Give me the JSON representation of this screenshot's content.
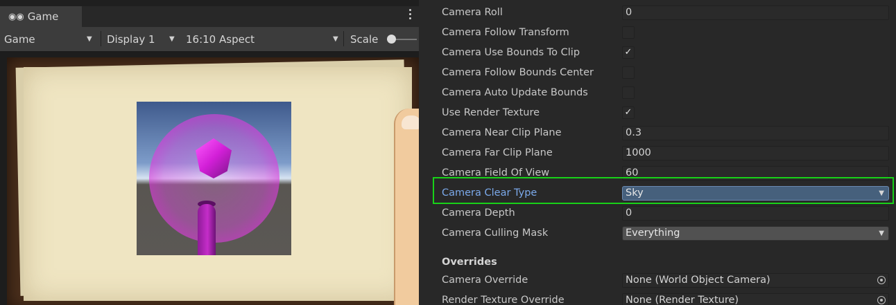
{
  "game_view": {
    "tab_label": "Game",
    "tab_icon": "gamepad-icon",
    "toolbar": {
      "mode": "Game",
      "display": "Display 1",
      "aspect": "16:10 Aspect",
      "scale_label": "Scale",
      "scale_value": 0.1
    }
  },
  "inspector": {
    "properties": [
      {
        "label": "Camera Roll",
        "kind": "field",
        "value": "0"
      },
      {
        "label": "Camera Follow Transform",
        "kind": "check",
        "value": ""
      },
      {
        "label": "Camera Use Bounds To Clip",
        "kind": "check",
        "value": "✓"
      },
      {
        "label": "Camera Follow Bounds Center",
        "kind": "check",
        "value": ""
      },
      {
        "label": "Camera Auto Update Bounds",
        "kind": "check",
        "value": ""
      },
      {
        "label": "Use Render Texture",
        "kind": "check",
        "value": "✓"
      },
      {
        "label": "Camera Near Clip Plane",
        "kind": "field",
        "value": "0.3"
      },
      {
        "label": "Camera Far Clip Plane",
        "kind": "field",
        "value": "1000"
      },
      {
        "label": "Camera Field Of View",
        "kind": "field",
        "value": "60"
      },
      {
        "label": "Camera Clear Type",
        "kind": "dropdown",
        "value": "Sky"
      },
      {
        "label": "Camera Depth",
        "kind": "field",
        "value": "0"
      },
      {
        "label": "Camera Culling Mask",
        "kind": "dropdown",
        "value": "Everything"
      }
    ],
    "overrides_heading": "Overrides",
    "overrides": [
      {
        "label": "Camera Override",
        "value": "None (World Object Camera)"
      },
      {
        "label": "Render Texture Override",
        "value": "None (Render Texture)"
      }
    ],
    "highlight_color": "#18d218",
    "active_label_color": "#7ba9ea"
  }
}
